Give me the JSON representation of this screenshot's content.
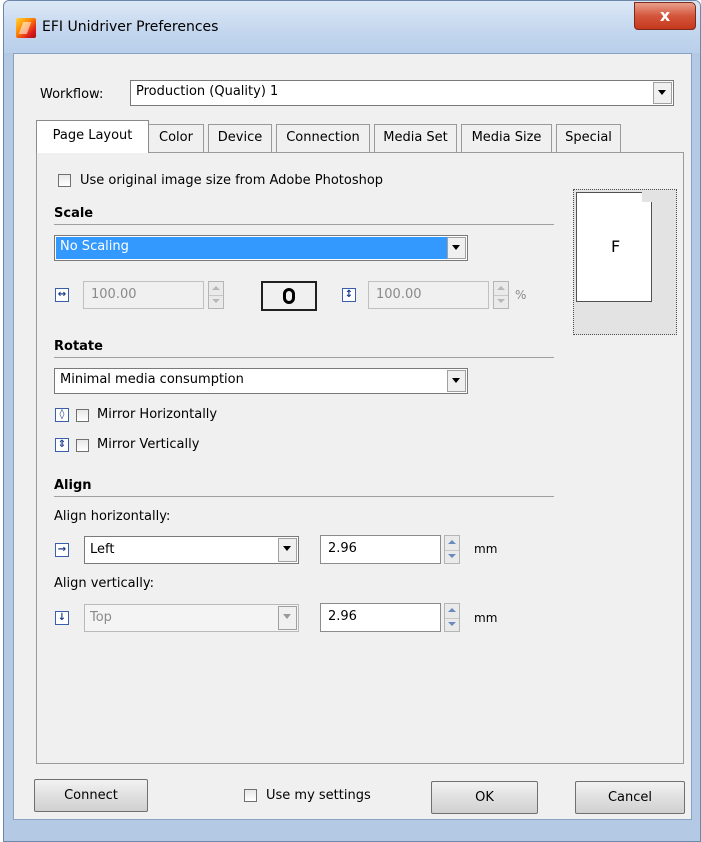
{
  "window": {
    "title": "EFI Unidriver Preferences",
    "close_glyph": "x"
  },
  "workflow": {
    "label": "Workflow:",
    "value": "Production (Quality) 1"
  },
  "tabs": [
    {
      "label": "Page Layout",
      "active": true
    },
    {
      "label": "Color"
    },
    {
      "label": "Device"
    },
    {
      "label": "Connection"
    },
    {
      "label": "Media Set"
    },
    {
      "label": "Media Size"
    },
    {
      "label": "Special"
    }
  ],
  "page_layout": {
    "use_original_size_label": "Use original image size from Adobe Photoshop",
    "scale": {
      "heading": "Scale",
      "mode": "No Scaling",
      "width_value": "100.00",
      "height_value": "100.00",
      "unit": "%"
    },
    "rotate": {
      "heading": "Rotate",
      "mode": "Minimal media consumption",
      "mirror_h_label": "Mirror Horizontally",
      "mirror_v_label": "Mirror Vertically"
    },
    "align": {
      "heading": "Align",
      "horizontal_label": "Align horizontally:",
      "horizontal_value": "Left",
      "horizontal_offset": "2.96",
      "vertical_label": "Align vertically:",
      "vertical_value": "Top",
      "vertical_offset": "2.96",
      "unit": "mm"
    },
    "preview_letter": "F"
  },
  "footer": {
    "connect_label": "Connect",
    "use_my_settings_label": "Use my settings",
    "ok_label": "OK",
    "cancel_label": "Cancel"
  }
}
